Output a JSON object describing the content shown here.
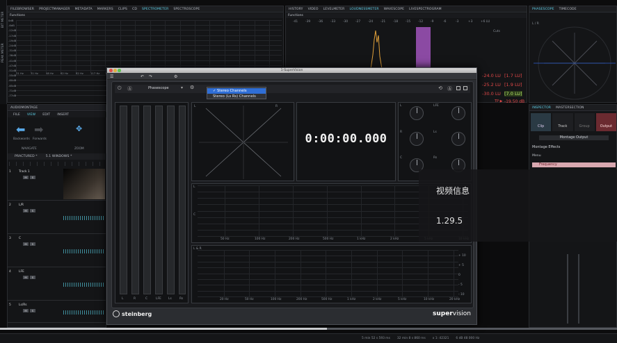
{
  "top_left_panel": {
    "tabs": [
      "FILEBROWSER",
      "PROJECTMANAGER",
      "METADATA",
      "MARKERS",
      "CLIPS",
      "CD",
      "SPECTROMETER",
      "SPECTROSCOPE"
    ],
    "active_tab": "SPECTROMETER",
    "functions_label": "Functions",
    "db_labels": [
      "0dB",
      "-6dB",
      "-12dB",
      "-17dB",
      "-19dB",
      "-24dB",
      "-31dB",
      "-36dB",
      "-41dB",
      "-47dB",
      "-51dB",
      "-55dB",
      "-60dB",
      "-65dB",
      "-71dB",
      "-77dB"
    ],
    "hz_labels": [
      "21 Hz",
      "31 Hz",
      "48 Hz",
      "62 Hz",
      "82 Hz",
      "117 Hz",
      "177 Hz",
      "259 Hz",
      "394 Hz",
      "519 Hz",
      "781 Hz",
      "1.2 kHz",
      "1.8 kHz",
      "2.7 kHz",
      "4472",
      "6932 Hz",
      "10746 Hz",
      "17591 Hz"
    ]
  },
  "top_mid_panel": {
    "tabs": [
      "HISTORY",
      "VIDEO",
      "LEVELMETER",
      "LOUDNESSMETER",
      "WAVESCOPE",
      "LIVESPECTROGRAM"
    ],
    "active_tab": "LOUDNESSMETER",
    "functions_label": "Functions",
    "scale": [
      "-41",
      "-39",
      "-36",
      "-33",
      "-30",
      "-27",
      "-24",
      "-21",
      "-18",
      "-15",
      "-12",
      "-9",
      "-6",
      "-3",
      "+3",
      "+6 LU"
    ],
    "readings": [
      {
        "value": "-24.0 LU",
        "extra": "[1.7 LU]",
        "color": "#e24848"
      },
      {
        "value": "-25.2 LU",
        "extra": "[1.9 LU]",
        "color": "#e24848"
      },
      {
        "value": "-30.0 LU",
        "extra": "[7.0 LU]",
        "color": "#e24848"
      },
      {
        "value": "TP ▶",
        "extra": "-19.50 dB",
        "color": "#e24848"
      }
    ],
    "cuts_label": "Cuts"
  },
  "top_right_panel": {
    "tabs": [
      "PHASESCOPE",
      "TIMECODE"
    ],
    "active_tab": "PHASESCOPE",
    "channel_label": "L / R"
  },
  "inspector": {
    "tabs": [
      "INSPECTOR",
      "MASTERSECTION"
    ],
    "active_tab": "INSPECTOR",
    "buttons": [
      "Clip",
      "Track",
      "Group",
      "Output"
    ],
    "dropdown": "Montage Output",
    "section": "Montage Effects",
    "menu_label": "Menu",
    "effect": "Frequency"
  },
  "left_strip": {
    "labels": [
      "BIT METER",
      "PEAK METER"
    ]
  },
  "audio_montage": {
    "title": "AUDIOMONTAGE",
    "ribbon_tabs": [
      "FILE",
      "VIEW",
      "EDIT",
      "INSERT"
    ],
    "active_tab": "VIEW",
    "nav_labels": [
      "Backwards",
      "Forwards"
    ],
    "groups": [
      "NAVIGATE",
      "ZOOM"
    ],
    "doc_tabs": [
      "Practured *",
      "5.1 Windows *"
    ],
    "tracks": [
      {
        "name": "Track 1",
        "num": "1"
      },
      {
        "name": "L/R",
        "num": "2"
      },
      {
        "name": "C",
        "num": "3"
      },
      {
        "name": "LFE",
        "num": "4"
      },
      {
        "name": "Ls/Rs",
        "num": "5"
      }
    ]
  },
  "supervision": {
    "window_title": "1-SuperVision",
    "module": "Phasescope",
    "menu_items": [
      "Stereo Channels",
      "Stereo (Ls Rs) Channels"
    ],
    "selected_item": "Stereo Channels",
    "timecode": "0:00:00.000",
    "phasescope_labels": [
      "L",
      "R"
    ],
    "surround_labels": [
      "L",
      "LFE",
      "R",
      "Ls",
      "C",
      "Rs"
    ],
    "spectrum1_labels": [
      "L",
      "C"
    ],
    "spectrum1_freq": [
      "50 Hz",
      "100 Hz",
      "200 Hz",
      "500 Hz",
      "1 kHz",
      "2 kHz",
      "5 kHz",
      "10 kHz"
    ],
    "spectrum2_label": "L & R",
    "spectrum2_freq": [
      "20 Hz",
      "50 Hz",
      "100 Hz",
      "200 Hz",
      "500 Hz",
      "1 kHz",
      "2 kHz",
      "5 kHz",
      "10 kHz",
      "20 kHz"
    ],
    "spectrum2_db": [
      "+ 10",
      "+ 5",
      "0",
      "- 5",
      "- 10"
    ],
    "meter_labels": [
      "L",
      "R",
      "C",
      "LFE",
      "Ls",
      "Rs"
    ],
    "brand": "steinberg",
    "product_bold": "super",
    "product_light": "vision"
  },
  "overlay": {
    "title": "视频信息",
    "value": "1.29.5"
  },
  "status_bar": {
    "items": [
      "5 min 52 s 593 ms",
      "32 min 8 s 860 ms",
      "x 1: 42321",
      "6 dB 48 000 Hz"
    ]
  },
  "video_progress": 0.53
}
